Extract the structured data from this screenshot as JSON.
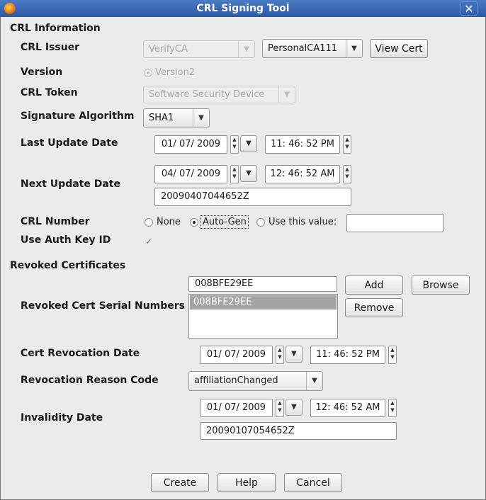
{
  "window": {
    "title": "CRL Signing Tool",
    "close_symbol": "✕"
  },
  "crl_info": {
    "section_title": "CRL Information",
    "issuer": {
      "label": "CRL Issuer",
      "ca_value": "VerifyCA",
      "cert_value": "PersonalCA111",
      "view_cert_label": "View Cert"
    },
    "version": {
      "label": "Version",
      "option": "Version2"
    },
    "token": {
      "label": "CRL Token",
      "value": "Software Security Device"
    },
    "signature": {
      "label": "Signature Algorithm",
      "value": "SHA1"
    },
    "last_update": {
      "label": "Last Update Date",
      "date": "01/ 07/  2009",
      "time": "11: 46: 52 PM"
    },
    "next_update": {
      "label": "Next Update Date",
      "date": "04/ 07/  2009",
      "time": "12: 46: 52 AM",
      "text": "20090407044652Z"
    },
    "crl_number": {
      "label": "CRL Number",
      "option_none": "None",
      "option_auto": "Auto-Gen",
      "option_value": "Use this value:",
      "value": ""
    },
    "auth_key": {
      "label": "Use Auth Key ID",
      "checked": true
    }
  },
  "revoked": {
    "section_title": "Revoked Certificates",
    "serials_label": "Revoked Cert Serial Numbers",
    "serial_input": "008BFE29EE",
    "add_label": "Add",
    "browse_label": "Browse",
    "remove_label": "Remove",
    "serial_list": [
      "008BFE29EE"
    ],
    "revocation_date": {
      "label": "Cert Revocation Date",
      "date": "01/ 07/  2009",
      "time": "11: 46: 52 PM"
    },
    "reason": {
      "label": "Revocation Reason Code",
      "value": "affiliationChanged"
    },
    "invalidity": {
      "label": "Invalidity Date",
      "date": "01/ 07/  2009",
      "time": "12: 46: 52 AM",
      "text": "20090107054652Z"
    }
  },
  "footer": {
    "create_label": "Create",
    "help_label": "Help",
    "cancel_label": "Cancel"
  },
  "icons": {
    "dropdown": "▼",
    "spin_up": "▲",
    "spin_down": "▼",
    "check": "✓"
  }
}
